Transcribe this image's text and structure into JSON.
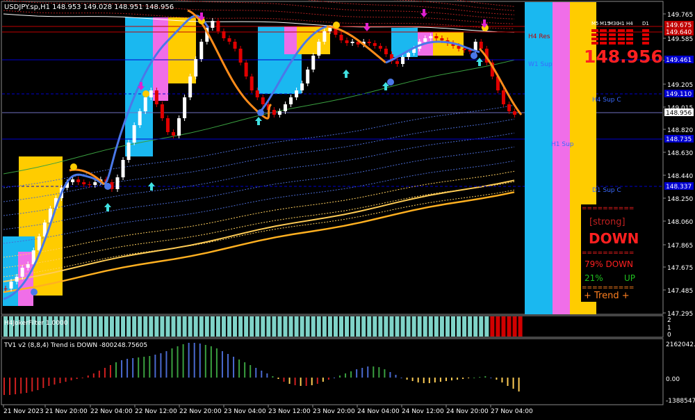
{
  "window": {
    "symbol_line": "USDJPY.sp,H1  148.953 149.028 148.951 148.956"
  },
  "main_pane": {
    "price_ticks": [
      "149.765",
      "149.585",
      "149.395",
      "149.205",
      "149.015",
      "148.820",
      "148.630",
      "148.440",
      "148.250",
      "148.060",
      "147.865",
      "147.675",
      "147.485",
      "147.295"
    ],
    "current_price": "148.956",
    "level_tags": [
      "149.675",
      "149.640",
      "149.461",
      "149.110",
      "148.735",
      "148.337"
    ],
    "level_labels": {
      "h4_res": "H4 Res",
      "w1_sup": "W1 Sup",
      "h4_sup": "H4 Sup C",
      "h1_sup": "H1 Sup",
      "d1_sup": "D1 Sup C"
    }
  },
  "mtf_panel": {
    "timeframes": [
      "M5",
      "M15",
      "M30",
      "H1",
      "H4",
      "D1"
    ],
    "big_price": "148.956",
    "divider": "==========",
    "strength": "[strong]",
    "direction": "DOWN",
    "down_line": "79% DOWN",
    "up_line": "21%",
    "up_label": "UP",
    "trend_line": "+ Trend +"
  },
  "joker_pane": {
    "label": "H4JokerFilter 1.0000",
    "ticks": [
      "2",
      "1",
      "0"
    ],
    "colors": {
      "up": "#7fd3c8",
      "down": "#d10000"
    }
  },
  "tv1_pane": {
    "label": "TV1 v2 (8,8,4) Trend is DOWN -800248.75605",
    "ticks": [
      "2162042.9",
      "0.00",
      "-1388547.1"
    ]
  },
  "time_axis": [
    "21 Nov 2023",
    "21 Nov 20:00",
    "22 Nov 04:00",
    "22 Nov 12:00",
    "22 Nov 20:00",
    "23 Nov 04:00",
    "23 Nov 12:00",
    "23 Nov 20:00",
    "24 Nov 04:00",
    "24 Nov 12:00",
    "24 Nov 20:00",
    "27 Nov 04:00"
  ],
  "colors": {
    "bull": "#ffffff",
    "bear": "#e00000",
    "cyan": "#1ab8f0",
    "pink": "#f06ee8",
    "yellow": "#ffcc00",
    "blue_line": "#4a78e8",
    "orange_line": "#ff8c1a",
    "level_blue": "#0000d0",
    "level_red": "#c00000"
  }
}
